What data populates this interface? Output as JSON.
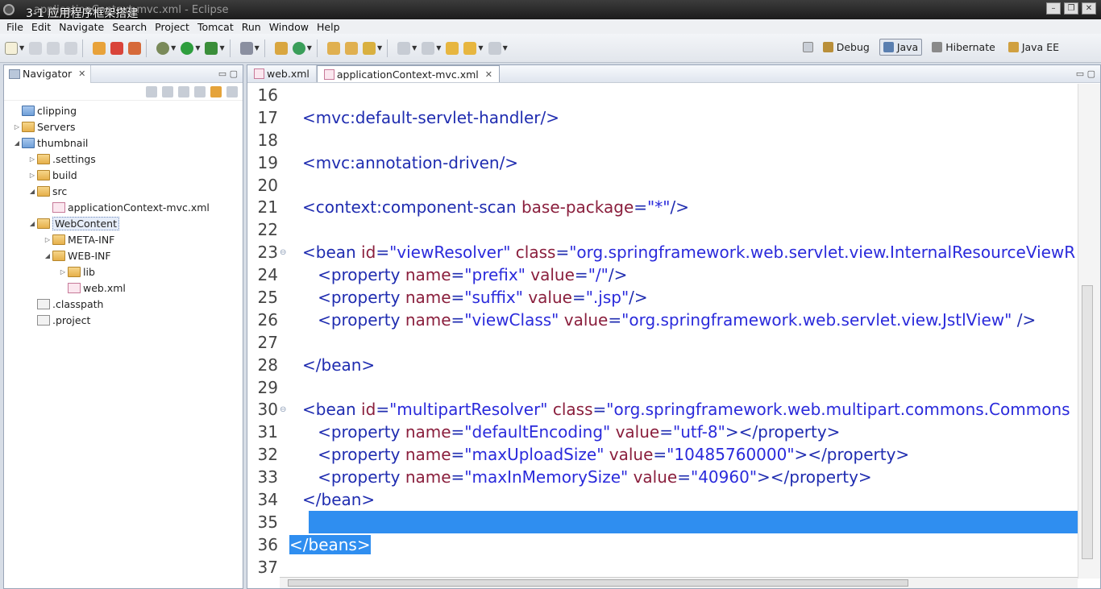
{
  "window": {
    "title_ghost": "applicationContext-mvc.xml - Eclipse",
    "overlay": "3-1  应用程序框架搭建"
  },
  "menu": [
    "File",
    "Edit",
    "Navigate",
    "Search",
    "Project",
    "Tomcat",
    "Run",
    "Window",
    "Help"
  ],
  "perspectives": [
    {
      "label": "Debug",
      "active": false
    },
    {
      "label": "Java",
      "active": true
    },
    {
      "label": "Hibernate",
      "active": false
    },
    {
      "label": "Java EE",
      "active": false
    }
  ],
  "navigator": {
    "tab_label": "Navigator",
    "items": [
      {
        "label": "clipping",
        "kind": "proj",
        "indent": 0,
        "twisty": ""
      },
      {
        "label": "Servers",
        "kind": "folder",
        "indent": 0,
        "twisty": "▷"
      },
      {
        "label": "thumbnail",
        "kind": "proj",
        "indent": 0,
        "twisty": "◢"
      },
      {
        "label": ".settings",
        "kind": "folder",
        "indent": 1,
        "twisty": "▷"
      },
      {
        "label": "build",
        "kind": "folder",
        "indent": 1,
        "twisty": "▷"
      },
      {
        "label": "src",
        "kind": "folder",
        "indent": 1,
        "twisty": "◢"
      },
      {
        "label": "applicationContext-mvc.xml",
        "kind": "xml",
        "indent": 2,
        "twisty": ""
      },
      {
        "label": "WebContent",
        "kind": "folder",
        "indent": 1,
        "twisty": "◢",
        "selected": true
      },
      {
        "label": "META-INF",
        "kind": "folder",
        "indent": 2,
        "twisty": "▷"
      },
      {
        "label": "WEB-INF",
        "kind": "folder",
        "indent": 2,
        "twisty": "◢"
      },
      {
        "label": "lib",
        "kind": "folder",
        "indent": 3,
        "twisty": "▷"
      },
      {
        "label": "web.xml",
        "kind": "xml",
        "indent": 3,
        "twisty": ""
      },
      {
        "label": ".classpath",
        "kind": "file",
        "indent": 1,
        "twisty": ""
      },
      {
        "label": ".project",
        "kind": "file",
        "indent": 1,
        "twisty": ""
      }
    ]
  },
  "editor": {
    "tabs": [
      {
        "label": "web.xml",
        "active": false
      },
      {
        "label": "applicationContext-mvc.xml",
        "active": true
      }
    ],
    "lines": [
      {
        "n": "16",
        "fold": "",
        "html": ""
      },
      {
        "n": "17",
        "fold": "",
        "parts": [
          [
            "tg",
            "<mvc:default-servlet-handler/>"
          ]
        ]
      },
      {
        "n": "18",
        "fold": "",
        "parts": []
      },
      {
        "n": "19",
        "fold": "",
        "parts": [
          [
            "tg",
            "<mvc:annotation-driven/>"
          ]
        ]
      },
      {
        "n": "20",
        "fold": "",
        "parts": []
      },
      {
        "n": "21",
        "fold": "",
        "parts": [
          [
            "tg",
            "<context:component-scan "
          ],
          [
            "an",
            "base-package"
          ],
          [
            "tg",
            "="
          ],
          [
            "av",
            "\"*\""
          ],
          [
            "tg",
            "/>"
          ]
        ]
      },
      {
        "n": "22",
        "fold": "",
        "parts": []
      },
      {
        "n": "23",
        "fold": "⊖",
        "parts": [
          [
            "tg",
            "<bean "
          ],
          [
            "an",
            "id"
          ],
          [
            "tg",
            "="
          ],
          [
            "av",
            "\"viewResolver\" "
          ],
          [
            "an",
            "class"
          ],
          [
            "tg",
            "="
          ],
          [
            "av",
            "\"org.springframework.web.servlet.view.InternalResourceViewR"
          ]
        ]
      },
      {
        "n": "24",
        "fold": "",
        "parts": [
          [
            "tg",
            "   <property "
          ],
          [
            "an",
            "name"
          ],
          [
            "tg",
            "="
          ],
          [
            "av",
            "\"prefix\" "
          ],
          [
            "an",
            "value"
          ],
          [
            "tg",
            "="
          ],
          [
            "av",
            "\"/\""
          ],
          [
            "tg",
            "/>"
          ]
        ]
      },
      {
        "n": "25",
        "fold": "",
        "parts": [
          [
            "tg",
            "   <property "
          ],
          [
            "an",
            "name"
          ],
          [
            "tg",
            "="
          ],
          [
            "av",
            "\"suffix\" "
          ],
          [
            "an",
            "value"
          ],
          [
            "tg",
            "="
          ],
          [
            "av",
            "\".jsp\""
          ],
          [
            "tg",
            "/>"
          ]
        ]
      },
      {
        "n": "26",
        "fold": "",
        "parts": [
          [
            "tg",
            "   <property "
          ],
          [
            "an",
            "name"
          ],
          [
            "tg",
            "="
          ],
          [
            "av",
            "\"viewClass\" "
          ],
          [
            "an",
            "value"
          ],
          [
            "tg",
            "="
          ],
          [
            "av",
            "\"org.springframework.web.servlet.view.JstlView\" "
          ],
          [
            "tg",
            "/>"
          ]
        ]
      },
      {
        "n": "27",
        "fold": "",
        "parts": []
      },
      {
        "n": "28",
        "fold": "",
        "parts": [
          [
            "tg",
            "</bean>"
          ]
        ]
      },
      {
        "n": "29",
        "fold": "",
        "parts": []
      },
      {
        "n": "30",
        "fold": "⊖",
        "parts": [
          [
            "tg",
            "<bean "
          ],
          [
            "an",
            "id"
          ],
          [
            "tg",
            "="
          ],
          [
            "av",
            "\"multipartResolver\" "
          ],
          [
            "an",
            "class"
          ],
          [
            "tg",
            "="
          ],
          [
            "av",
            "\"org.springframework.web.multipart.commons.Commons"
          ]
        ]
      },
      {
        "n": "31",
        "fold": "",
        "parts": [
          [
            "tg",
            "   <property "
          ],
          [
            "an",
            "name"
          ],
          [
            "tg",
            "="
          ],
          [
            "av",
            "\"defaultEncoding\" "
          ],
          [
            "an",
            "value"
          ],
          [
            "tg",
            "="
          ],
          [
            "av",
            "\"utf-8\""
          ],
          [
            "tg",
            "></property>"
          ]
        ]
      },
      {
        "n": "32",
        "fold": "",
        "parts": [
          [
            "tg",
            "   <property "
          ],
          [
            "an",
            "name"
          ],
          [
            "tg",
            "="
          ],
          [
            "av",
            "\"maxUploadSize\" "
          ],
          [
            "an",
            "value"
          ],
          [
            "tg",
            "="
          ],
          [
            "av",
            "\"10485760000\""
          ],
          [
            "tg",
            "></property>"
          ]
        ]
      },
      {
        "n": "33",
        "fold": "",
        "parts": [
          [
            "tg",
            "   <property "
          ],
          [
            "an",
            "name"
          ],
          [
            "tg",
            "="
          ],
          [
            "av",
            "\"maxInMemorySize\" "
          ],
          [
            "an",
            "value"
          ],
          [
            "tg",
            "="
          ],
          [
            "av",
            "\"40960\""
          ],
          [
            "tg",
            "></property>"
          ]
        ]
      },
      {
        "n": "34",
        "fold": "",
        "parts": [
          [
            "tg",
            "</bean>"
          ]
        ]
      },
      {
        "n": "35",
        "fold": "",
        "parts": [],
        "highlight": true
      },
      {
        "n": "36",
        "fold": "",
        "parts": [
          [
            "sl",
            "</beans>"
          ]
        ],
        "outdent": true
      },
      {
        "n": "37",
        "fold": "",
        "parts": []
      }
    ]
  },
  "colors": {
    "selection": "#2f8ef0",
    "tag": "#1f2cb0",
    "attr_name": "#8a1f3d",
    "attr_value": "#2a2adb"
  }
}
